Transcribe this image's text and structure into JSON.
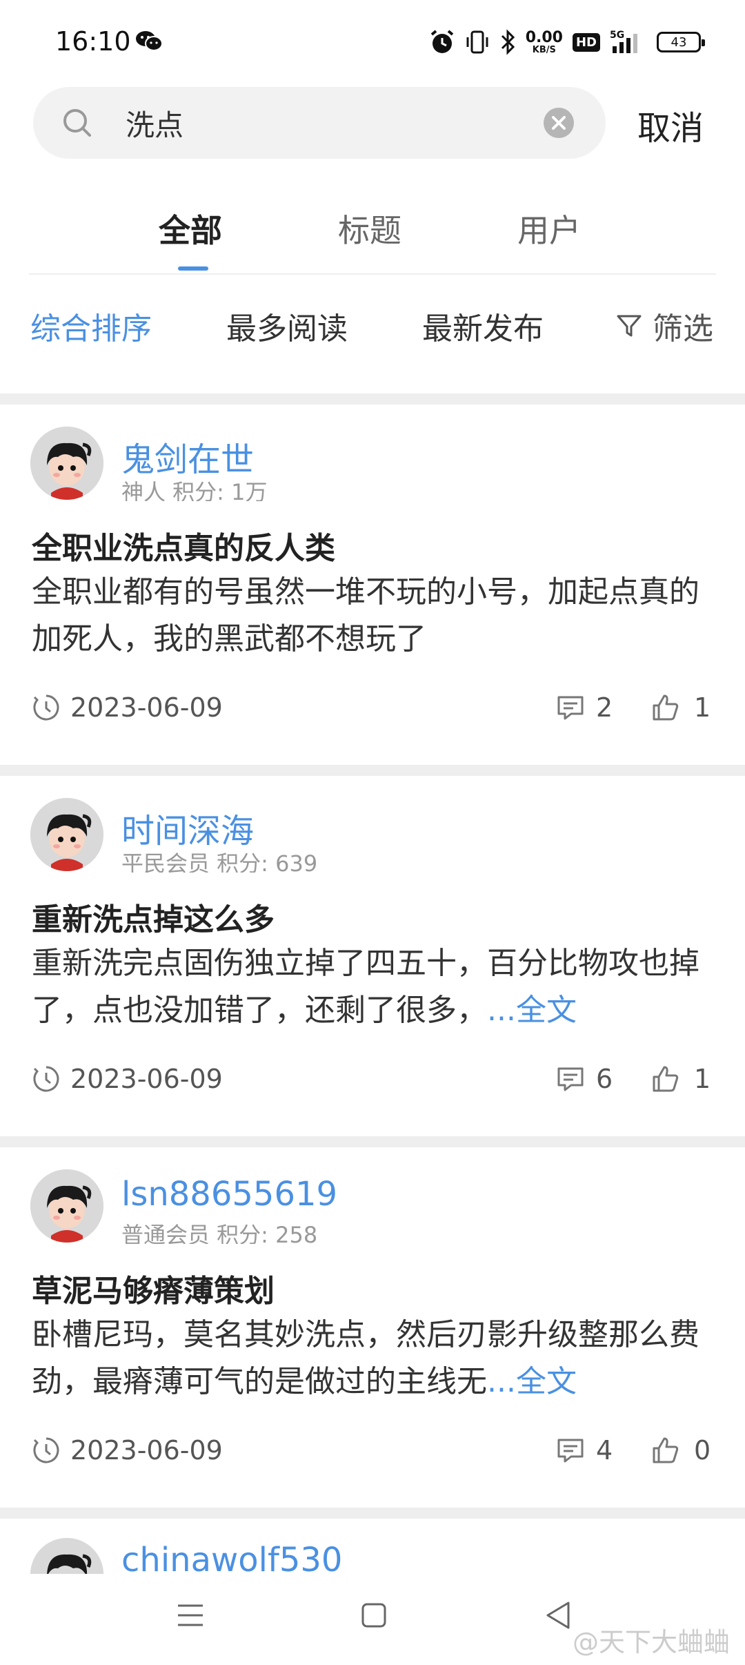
{
  "status_bar": {
    "time": "16:10",
    "net_speed_value": "0.00",
    "net_speed_unit": "KB/S",
    "hd_label": "HD",
    "network_label": "5G",
    "battery": "43",
    "icons": [
      "wechat-icon",
      "alarm-icon",
      "vibrate-icon",
      "bluetooth-icon",
      "signal-icon",
      "battery-icon"
    ]
  },
  "search": {
    "query": "洗点",
    "cancel_label": "取消"
  },
  "tabs": [
    {
      "label": "全部",
      "active": true
    },
    {
      "label": "标题",
      "active": false
    },
    {
      "label": "用户",
      "active": false
    }
  ],
  "sort": {
    "items": [
      {
        "label": "综合排序",
        "active": true
      },
      {
        "label": "最多阅读",
        "active": false
      },
      {
        "label": "最新发布",
        "active": false
      }
    ],
    "filter_label": "筛选"
  },
  "posts": [
    {
      "username": "鬼剑在世",
      "userinfo": "神人 积分: 1万",
      "title": "全职业洗点真的反人类",
      "excerpt": "全职业都有的号虽然一堆不玩的小号，加起点真的加死人，我的黑武都不想玩了",
      "more": "",
      "date": "2023-06-09",
      "comments": "2",
      "likes": "1"
    },
    {
      "username": "时间深海",
      "userinfo": "平民会员 积分: 639",
      "title": "重新洗点掉这么多",
      "excerpt": "重新洗完点固伤独立掉了四五十，百分比物攻也掉了，点也没加错了，还剩了很多，",
      "more": "...全文",
      "date": "2023-06-09",
      "comments": "6",
      "likes": "1"
    },
    {
      "username": "lsn88655619",
      "userinfo": "普通会员 积分: 258",
      "title": "草泥马够瘠薄策划",
      "excerpt": "卧槽尼玛，莫名其妙洗点，然后刃影升级整那么费劲，最瘠薄可气的是做过的主线无",
      "more": "...全文",
      "date": "2023-06-09",
      "comments": "4",
      "likes": "0"
    },
    {
      "username": "chinawolf530",
      "userinfo": "",
      "title": "",
      "excerpt": "",
      "more": "",
      "date": "",
      "comments": "",
      "likes": ""
    }
  ],
  "watermark": "@天下大蛐蛐",
  "colors": {
    "accent": "#4a90e2",
    "separator": "#eeeeee",
    "search_bg": "#f2f2f2"
  }
}
